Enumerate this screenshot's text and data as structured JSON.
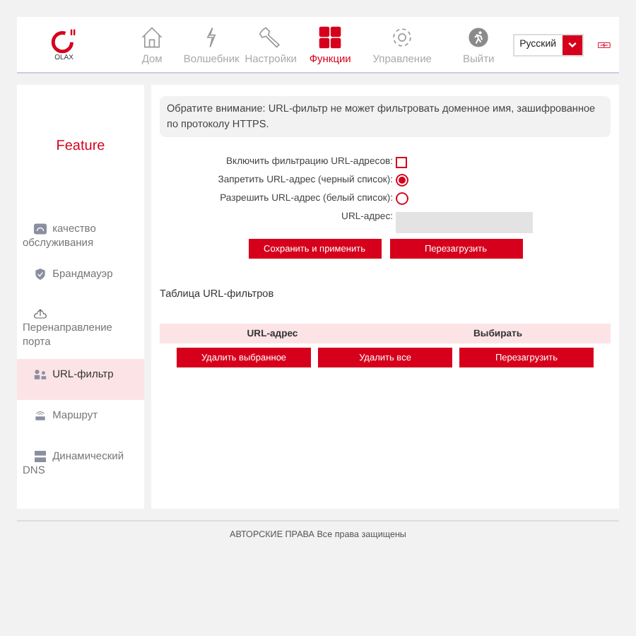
{
  "logo": {
    "text": "OLAX"
  },
  "nav": [
    {
      "label": "Дом",
      "kind": "home",
      "selected": false
    },
    {
      "label": "Волшебник",
      "kind": "bolt",
      "selected": false
    },
    {
      "label": "Настройки",
      "kind": "wrench",
      "selected": false
    },
    {
      "label": "Функции",
      "kind": "grid",
      "selected": true
    },
    {
      "label": "Управление",
      "kind": "gear",
      "selected": false
    },
    {
      "label": "Выйти",
      "kind": "exit",
      "selected": false
    }
  ],
  "language": {
    "value": "Русский"
  },
  "sidebar": {
    "title": "Feature",
    "items": [
      {
        "label": "качество обслуживания",
        "kind": "qos",
        "selected": false
      },
      {
        "label": "Брандмауэр",
        "kind": "shield",
        "selected": false
      },
      {
        "label": "Перенаправление порта",
        "kind": "cloud",
        "selected": false
      },
      {
        "label": "URL-фильтр",
        "kind": "users",
        "selected": true
      },
      {
        "label": "Маршрут",
        "kind": "router",
        "selected": false
      },
      {
        "label": "Динамический DNS",
        "kind": "server",
        "selected": false
      }
    ]
  },
  "notice": "Обратите внимание: URL-фильтр не может фильтровать доменное имя, зашифрованное по протоколу HTTPS.",
  "form": [
    {
      "kind": "checkbox",
      "label": "Включить фильтрацию URL-адресов:",
      "checked": false
    },
    {
      "kind": "radio",
      "label": "Запретить URL-адрес (черный список):",
      "checked": true
    },
    {
      "kind": "radio",
      "label": "Разрешить URL-адрес (белый список):",
      "checked": false
    },
    {
      "kind": "input",
      "label": "URL-адрес:",
      "disabled": true
    }
  ],
  "form_buttons": [
    "Сохранить и применить",
    "Перезагрузить"
  ],
  "table": {
    "title": "Таблица URL-фильтров",
    "columns": [
      "URL-адрес",
      "Выбирать"
    ]
  },
  "table_buttons": [
    "Удалить выбранное",
    "Удалить все",
    "Перезагрузить"
  ],
  "footer": "АВТОРСКИЕ ПРАВА Все права защищены"
}
